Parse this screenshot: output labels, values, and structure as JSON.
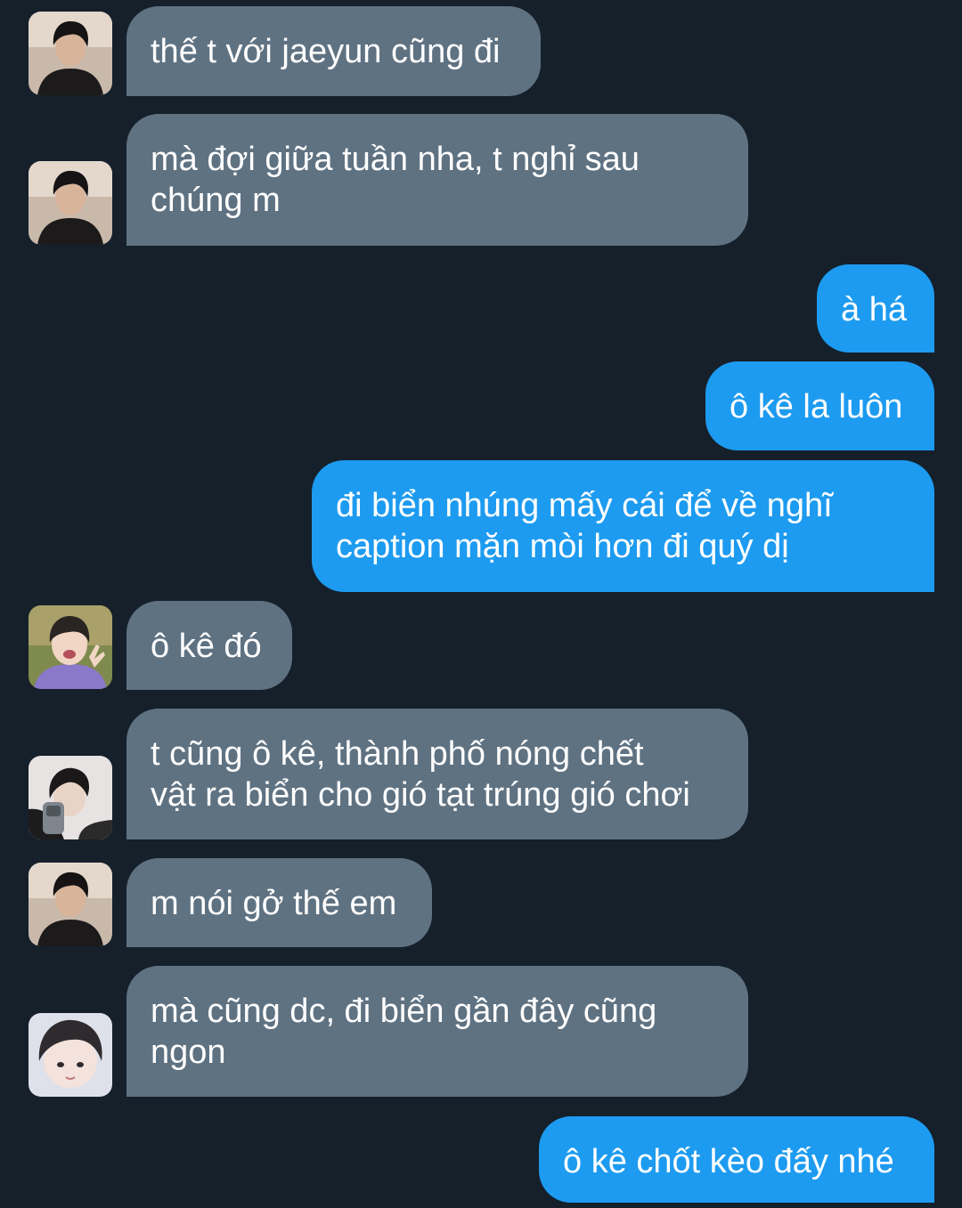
{
  "colors": {
    "background": "#15202b",
    "incoming_bubble": "#5f7282",
    "outgoing_bubble": "#1d9bf0",
    "text": "#ffffff"
  },
  "messages": [
    {
      "direction": "incoming",
      "avatar": "avatar-a",
      "text": "thế t với jaeyun cũng đi"
    },
    {
      "direction": "incoming",
      "avatar": "avatar-a",
      "text": "mà đợi giữa tuần nha, t nghỉ sau\nchúng m"
    },
    {
      "direction": "outgoing",
      "text": "à há"
    },
    {
      "direction": "outgoing",
      "text": "ô kê la luôn"
    },
    {
      "direction": "outgoing",
      "text": "đi biển nhúng mấy cái để về nghĩ\ncaption mặn mòi hơn đi quý dị"
    },
    {
      "direction": "incoming",
      "avatar": "avatar-b",
      "text": "ô kê đó"
    },
    {
      "direction": "incoming",
      "avatar": "avatar-c",
      "text": "t cũng ô kê, thành phố nóng chết\nvật ra biển cho gió tạt trúng gió chơi"
    },
    {
      "direction": "incoming",
      "avatar": "avatar-a",
      "text": "m nói gở thế em"
    },
    {
      "direction": "incoming",
      "avatar": "avatar-d",
      "text": "mà cũng dc, đi biển gần đây cũng\nngon"
    },
    {
      "direction": "outgoing",
      "text": "ô kê chốt kèo đấy nhé"
    }
  ]
}
